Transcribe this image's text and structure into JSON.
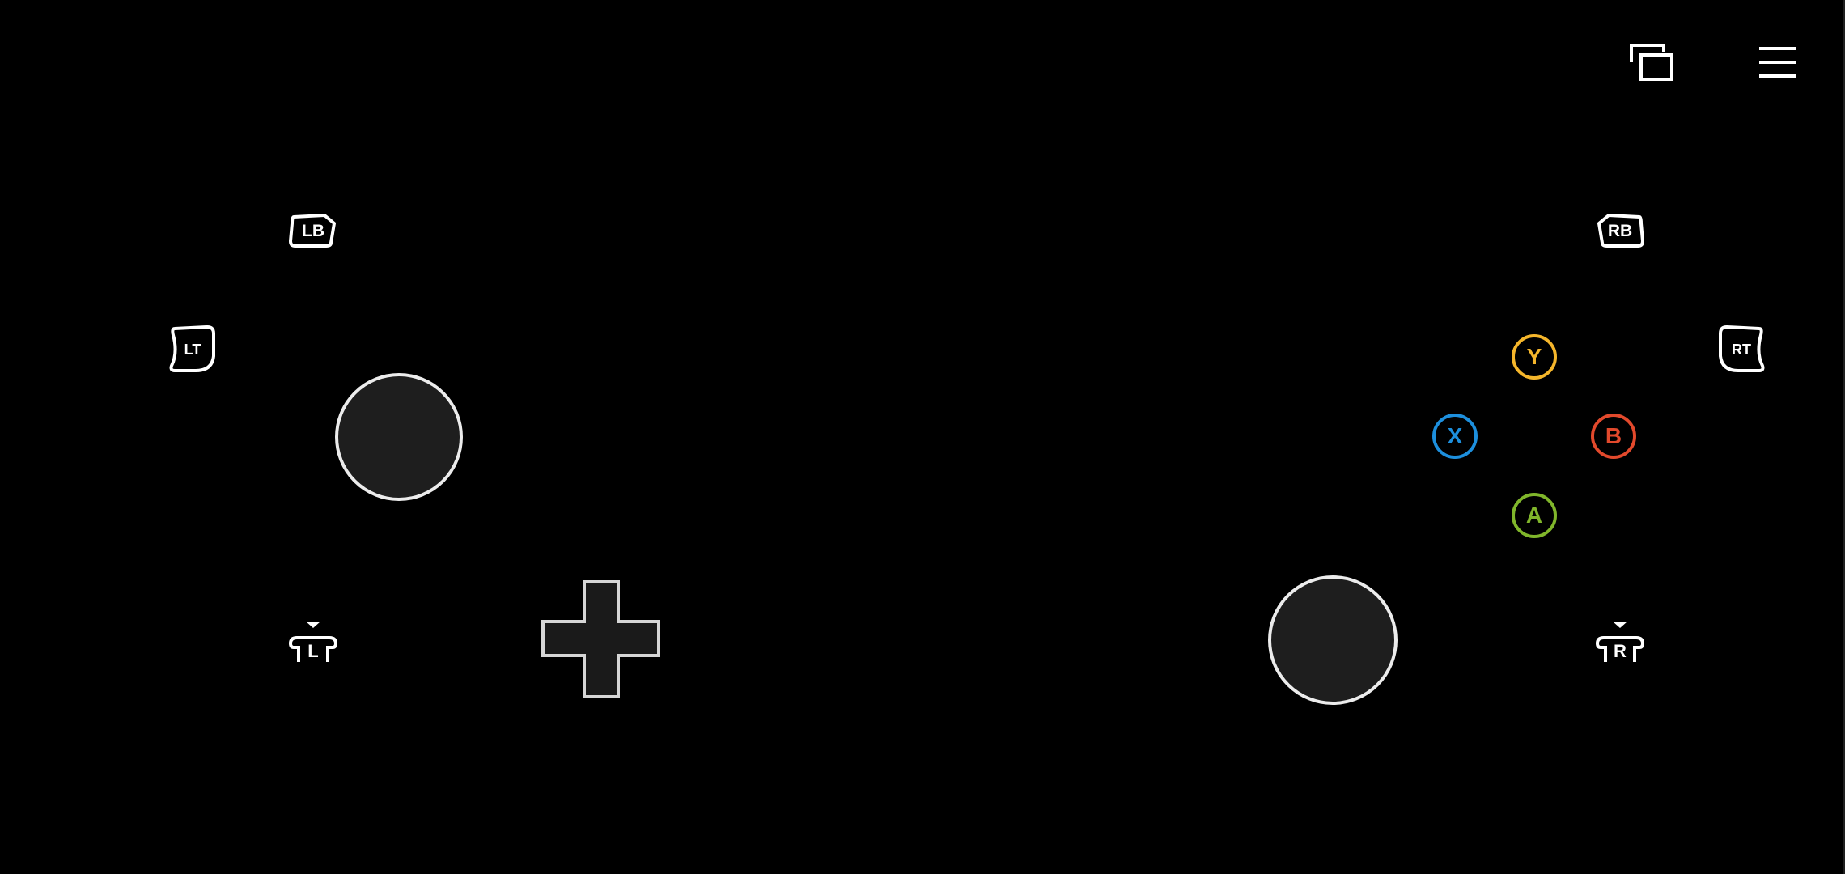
{
  "top_bar": {
    "switch_icon": "switch-screen-icon",
    "menu_icon": "hamburger-menu-icon"
  },
  "shoulder": {
    "lb": "LB",
    "rb": "RB"
  },
  "triggers": {
    "lt": "LT",
    "rt": "RT"
  },
  "stick_clicks": {
    "left": "L",
    "right": "R"
  },
  "face_buttons": {
    "y": "Y",
    "x": "X",
    "b": "B",
    "a": "A"
  },
  "colors": {
    "background": "#000000",
    "outline": "#ffffff",
    "stick_fill": "#1e1e1e",
    "y": "#f5b62b",
    "x": "#1d8fdd",
    "b": "#e2492c",
    "a": "#80b62b"
  }
}
